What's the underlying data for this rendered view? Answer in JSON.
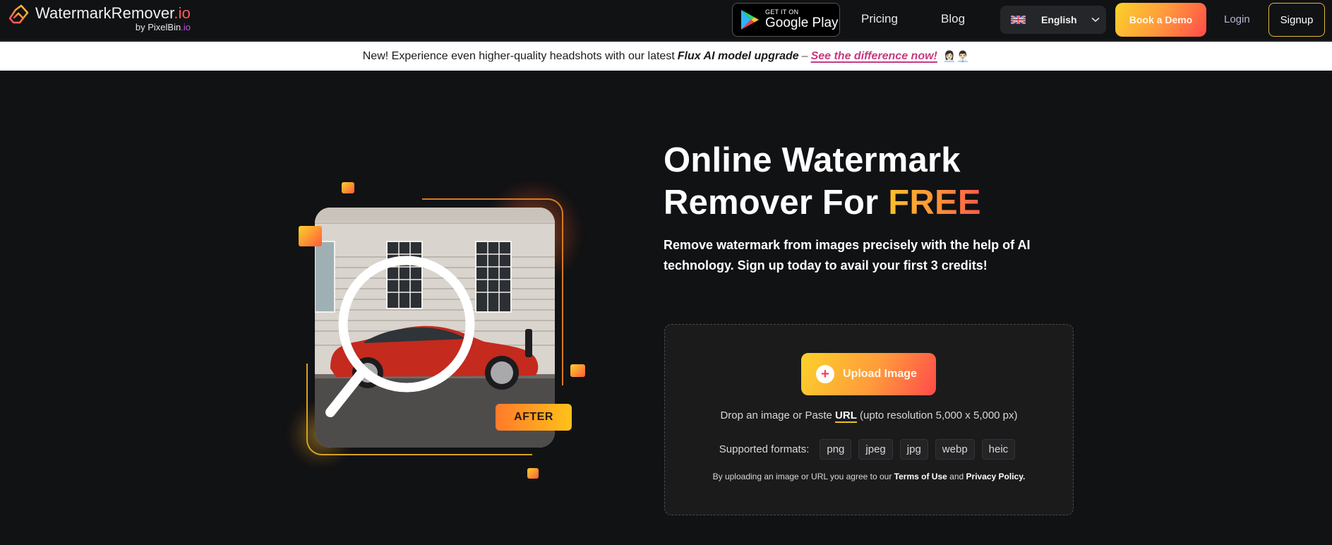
{
  "header": {
    "logo_title": "WatermarkRemover",
    "logo_title_suffix": ".io",
    "logo_sub_prefix": "by PixelBin",
    "logo_sub_suffix": ".io",
    "google_play_small": "GET IT ON",
    "google_play_big": "Google Play",
    "nav": [
      {
        "label": "Pricing"
      },
      {
        "label": "Blog"
      }
    ],
    "language": {
      "selected": "English",
      "flag": "uk-flag"
    },
    "book_demo": "Book a Demo",
    "login": "Login",
    "signup": "Signup"
  },
  "banner": {
    "text": "New! Experience even higher-quality headshots with our latest",
    "bold": "Flux AI model upgrade",
    "dash": "–",
    "link": "See the difference now!",
    "emoji": "👩🏻‍💼👨🏻‍💼"
  },
  "hero": {
    "title_line1": "Online Watermark",
    "title_line2_prefix": "Remover For ",
    "title_highlight": "FREE",
    "subtitle": "Remove watermark from images precisely with the help of AI technology. Sign up today to avail your first 3 credits!",
    "illustration_badge": "AFTER"
  },
  "upload": {
    "button_label": "Upload Image",
    "drop_prefix": "Drop an image or Paste ",
    "drop_link": "URL",
    "drop_suffix": " (upto resolution 5,000 x 5,000 px)",
    "formats_label": "Supported formats:",
    "formats": [
      "png",
      "jpeg",
      "jpg",
      "webp",
      "heic"
    ],
    "legal_prefix": "By uploading an image or URL you agree to our ",
    "terms": "Terms of Use",
    "legal_and": " and ",
    "privacy": "Privacy Policy."
  },
  "colors": {
    "background": "#111214",
    "accent_gradient_start": "#fbd22a",
    "accent_gradient_end": "#ff4a4a",
    "banner_link": "#c73a82",
    "signup_border": "#e2b93b"
  }
}
